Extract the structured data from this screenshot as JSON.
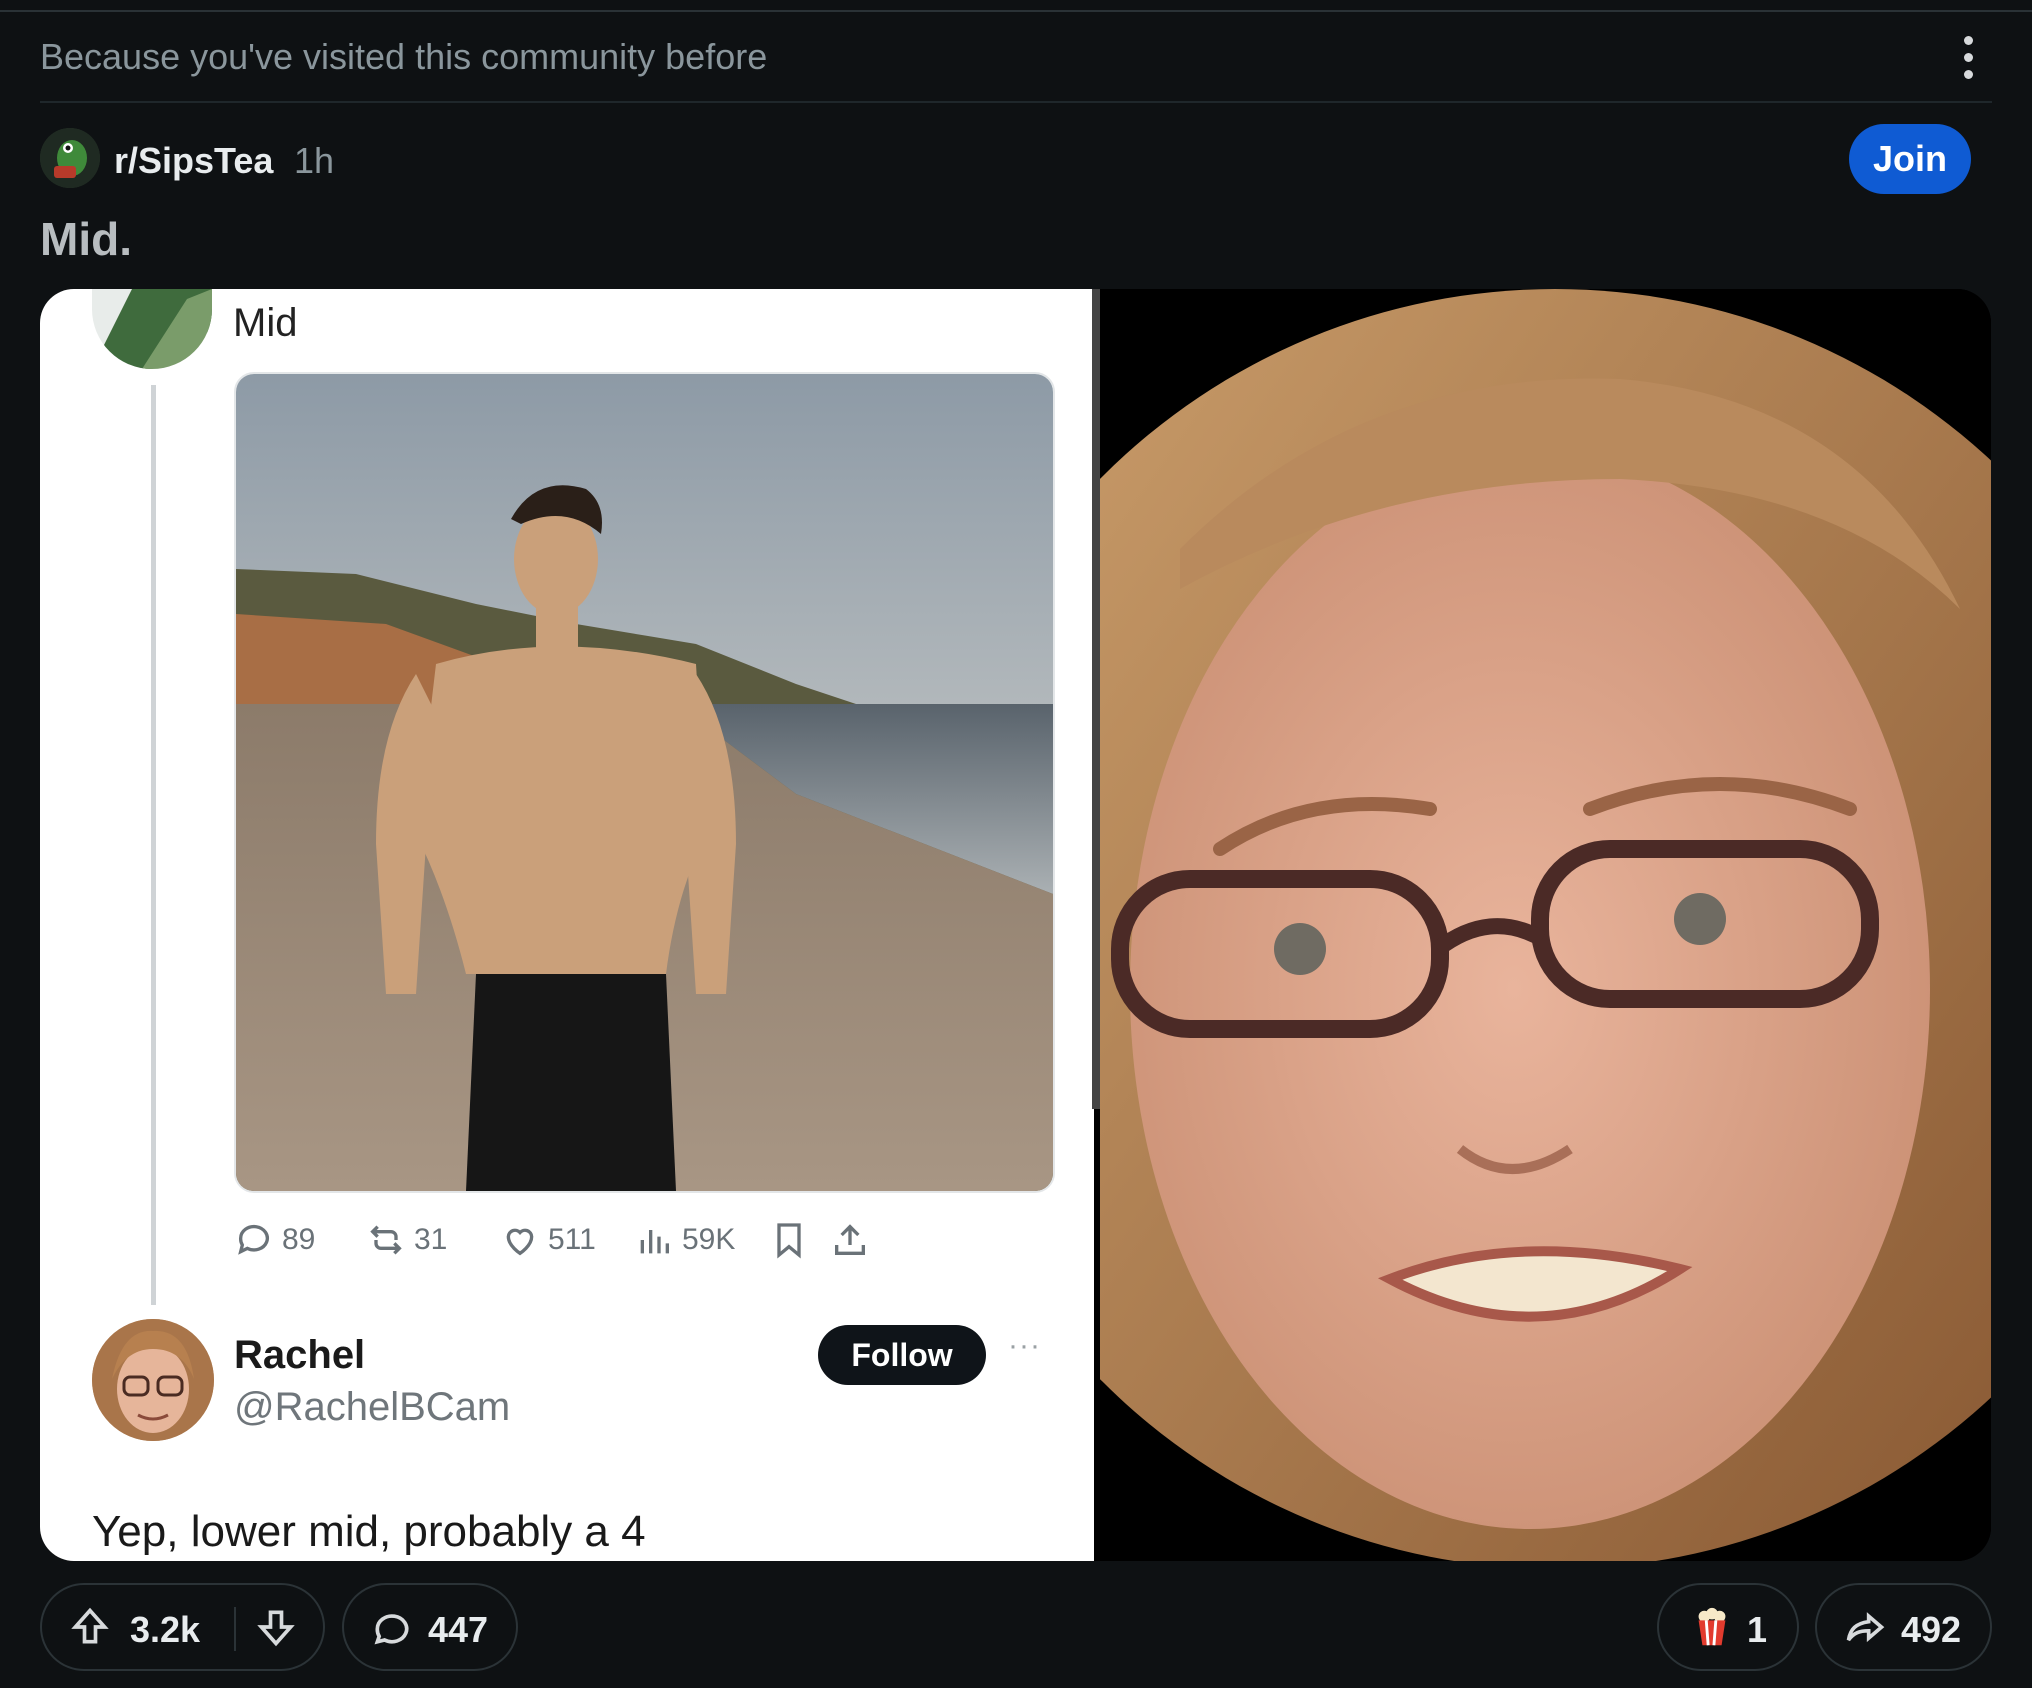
{
  "feed": {
    "reason": "Because you've visited this community before"
  },
  "post": {
    "subreddit": "r/SipsTea",
    "time": "1h",
    "join_label": "Join",
    "title": "Mid."
  },
  "embedded_tweet": {
    "quoted_text": "Mid",
    "stats": {
      "replies": "89",
      "reposts": "31",
      "likes": "511",
      "views": "59K"
    },
    "reply": {
      "name": "Rachel",
      "handle": "@RachelBCam",
      "follow_label": "Follow",
      "more": "···",
      "text": "Yep, lower mid, probably a 4"
    }
  },
  "footer": {
    "upvotes": "3.2k",
    "comments": "447",
    "awards": "1",
    "shares": "492"
  },
  "colors": {
    "background": "#0e1113",
    "join": "#0f5bd3",
    "text": "#d7dadc"
  }
}
